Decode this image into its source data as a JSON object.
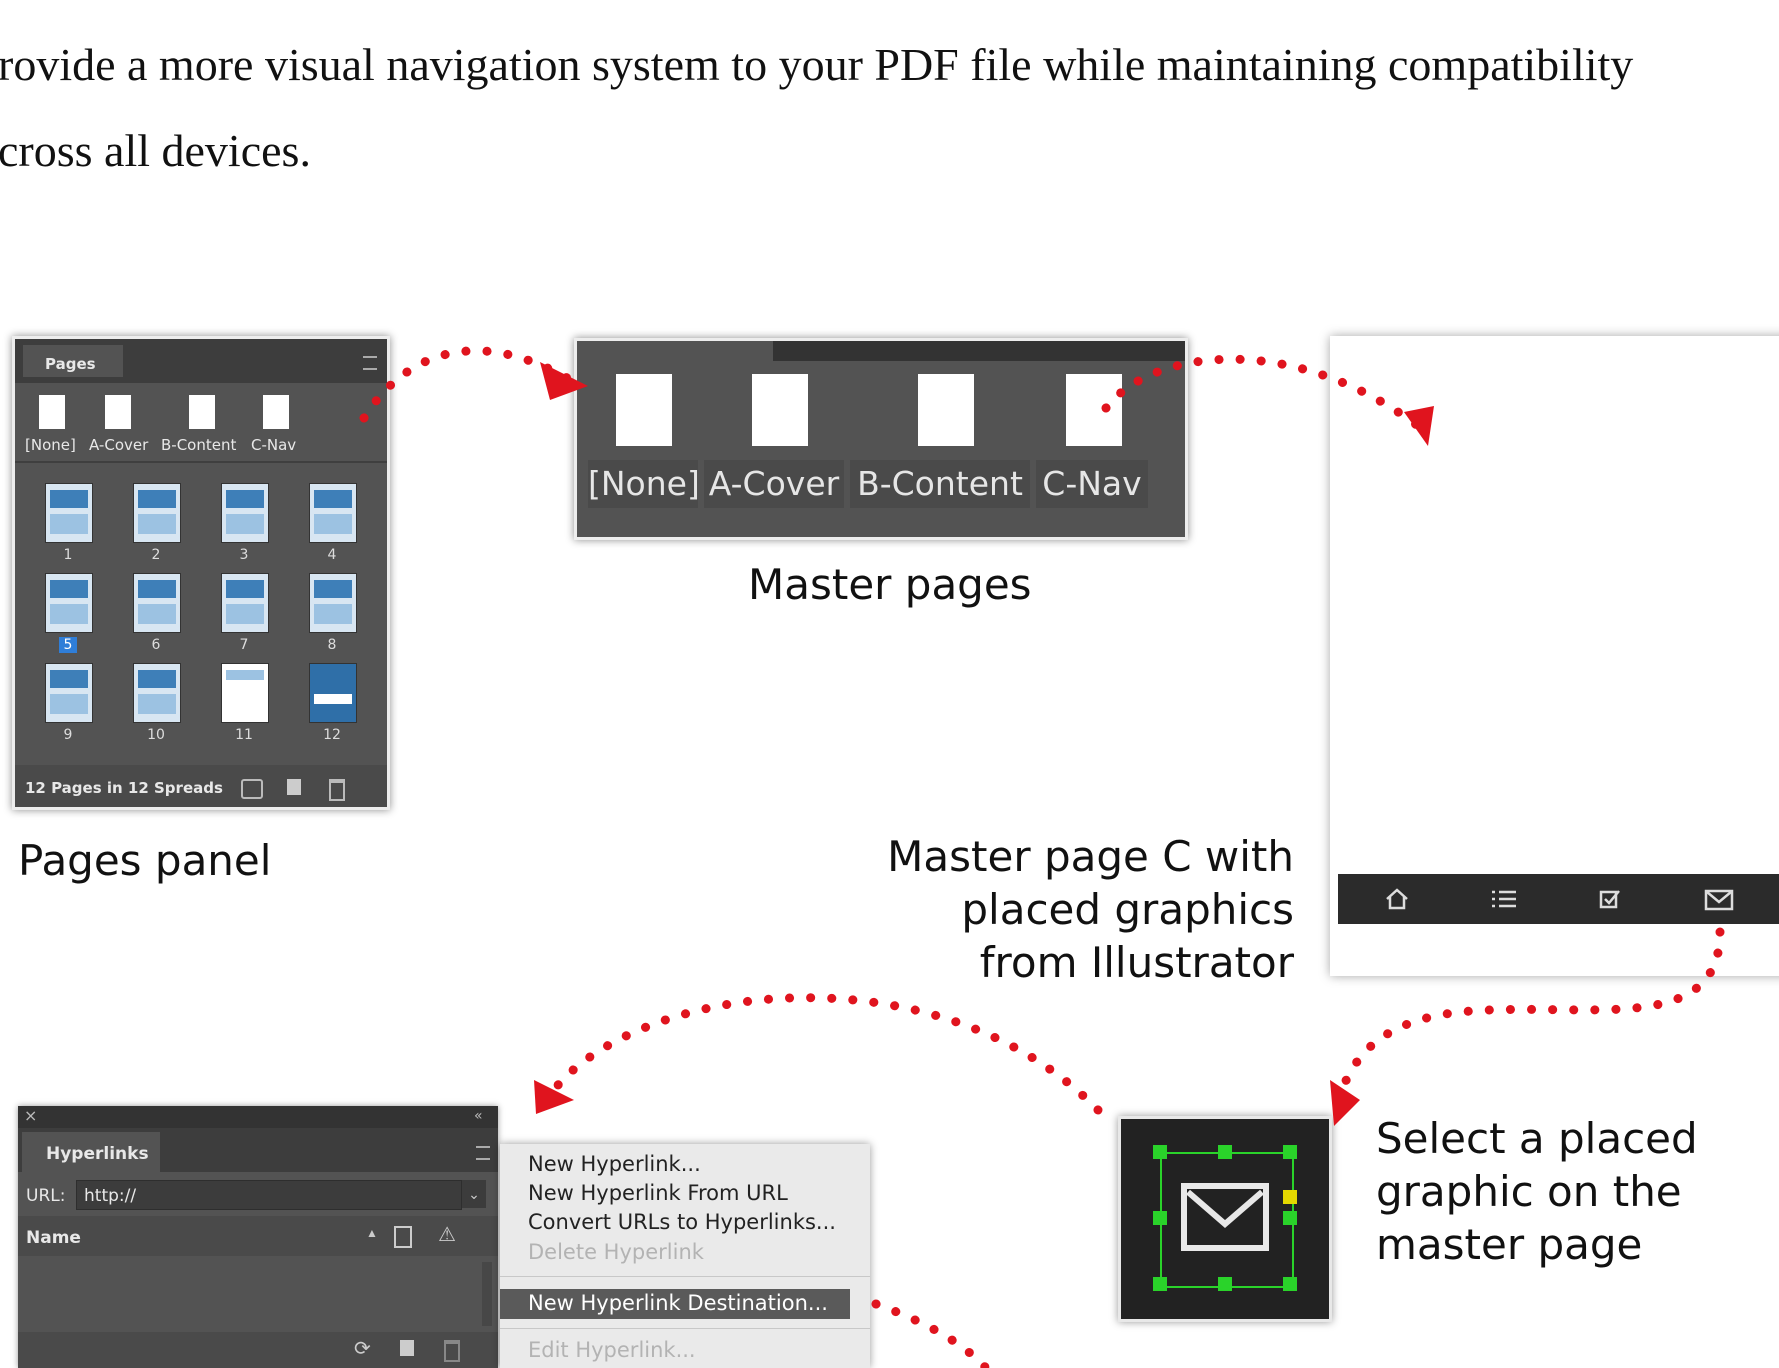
{
  "paragraph": "rovide a more visual navigation system to your PDF file while maintaining compatibility\ncross all devices.",
  "pages_panel": {
    "title": "Pages",
    "masters": [
      "[None]",
      "A-Cover",
      "B-Content",
      "C-Nav"
    ],
    "page_numbers": [
      "1",
      "2",
      "3",
      "4",
      "5",
      "6",
      "7",
      "8",
      "9",
      "10",
      "11",
      "12"
    ],
    "footer": "12 Pages in 12 Spreads",
    "caption": "Pages panel"
  },
  "master_pages": {
    "labels": [
      "[None]",
      "A-Cover",
      "B-Content",
      "C-Nav"
    ],
    "caption": "Master pages"
  },
  "master_c_caption": "Master page C with\nplaced graphics\nfrom Illustrator",
  "select_caption": "Select a placed\ngraphic on the\nmaster page",
  "hyperlinks_panel": {
    "title": "Hyperlinks",
    "url_label": "URL:",
    "url_value": "http://",
    "name_label": "Name"
  },
  "context_menu": {
    "items": [
      "New Hyperlink...",
      "New Hyperlink From URL",
      "Convert URLs to Hyperlinks...",
      "Delete Hyperlink",
      "New Hyperlink Destination...",
      "Edit Hyperlink..."
    ]
  },
  "colors": {
    "arrow": "#e0141e",
    "panel": "#535353",
    "nav_bar": "#2b2b2b",
    "selection": "#2ad32a"
  }
}
